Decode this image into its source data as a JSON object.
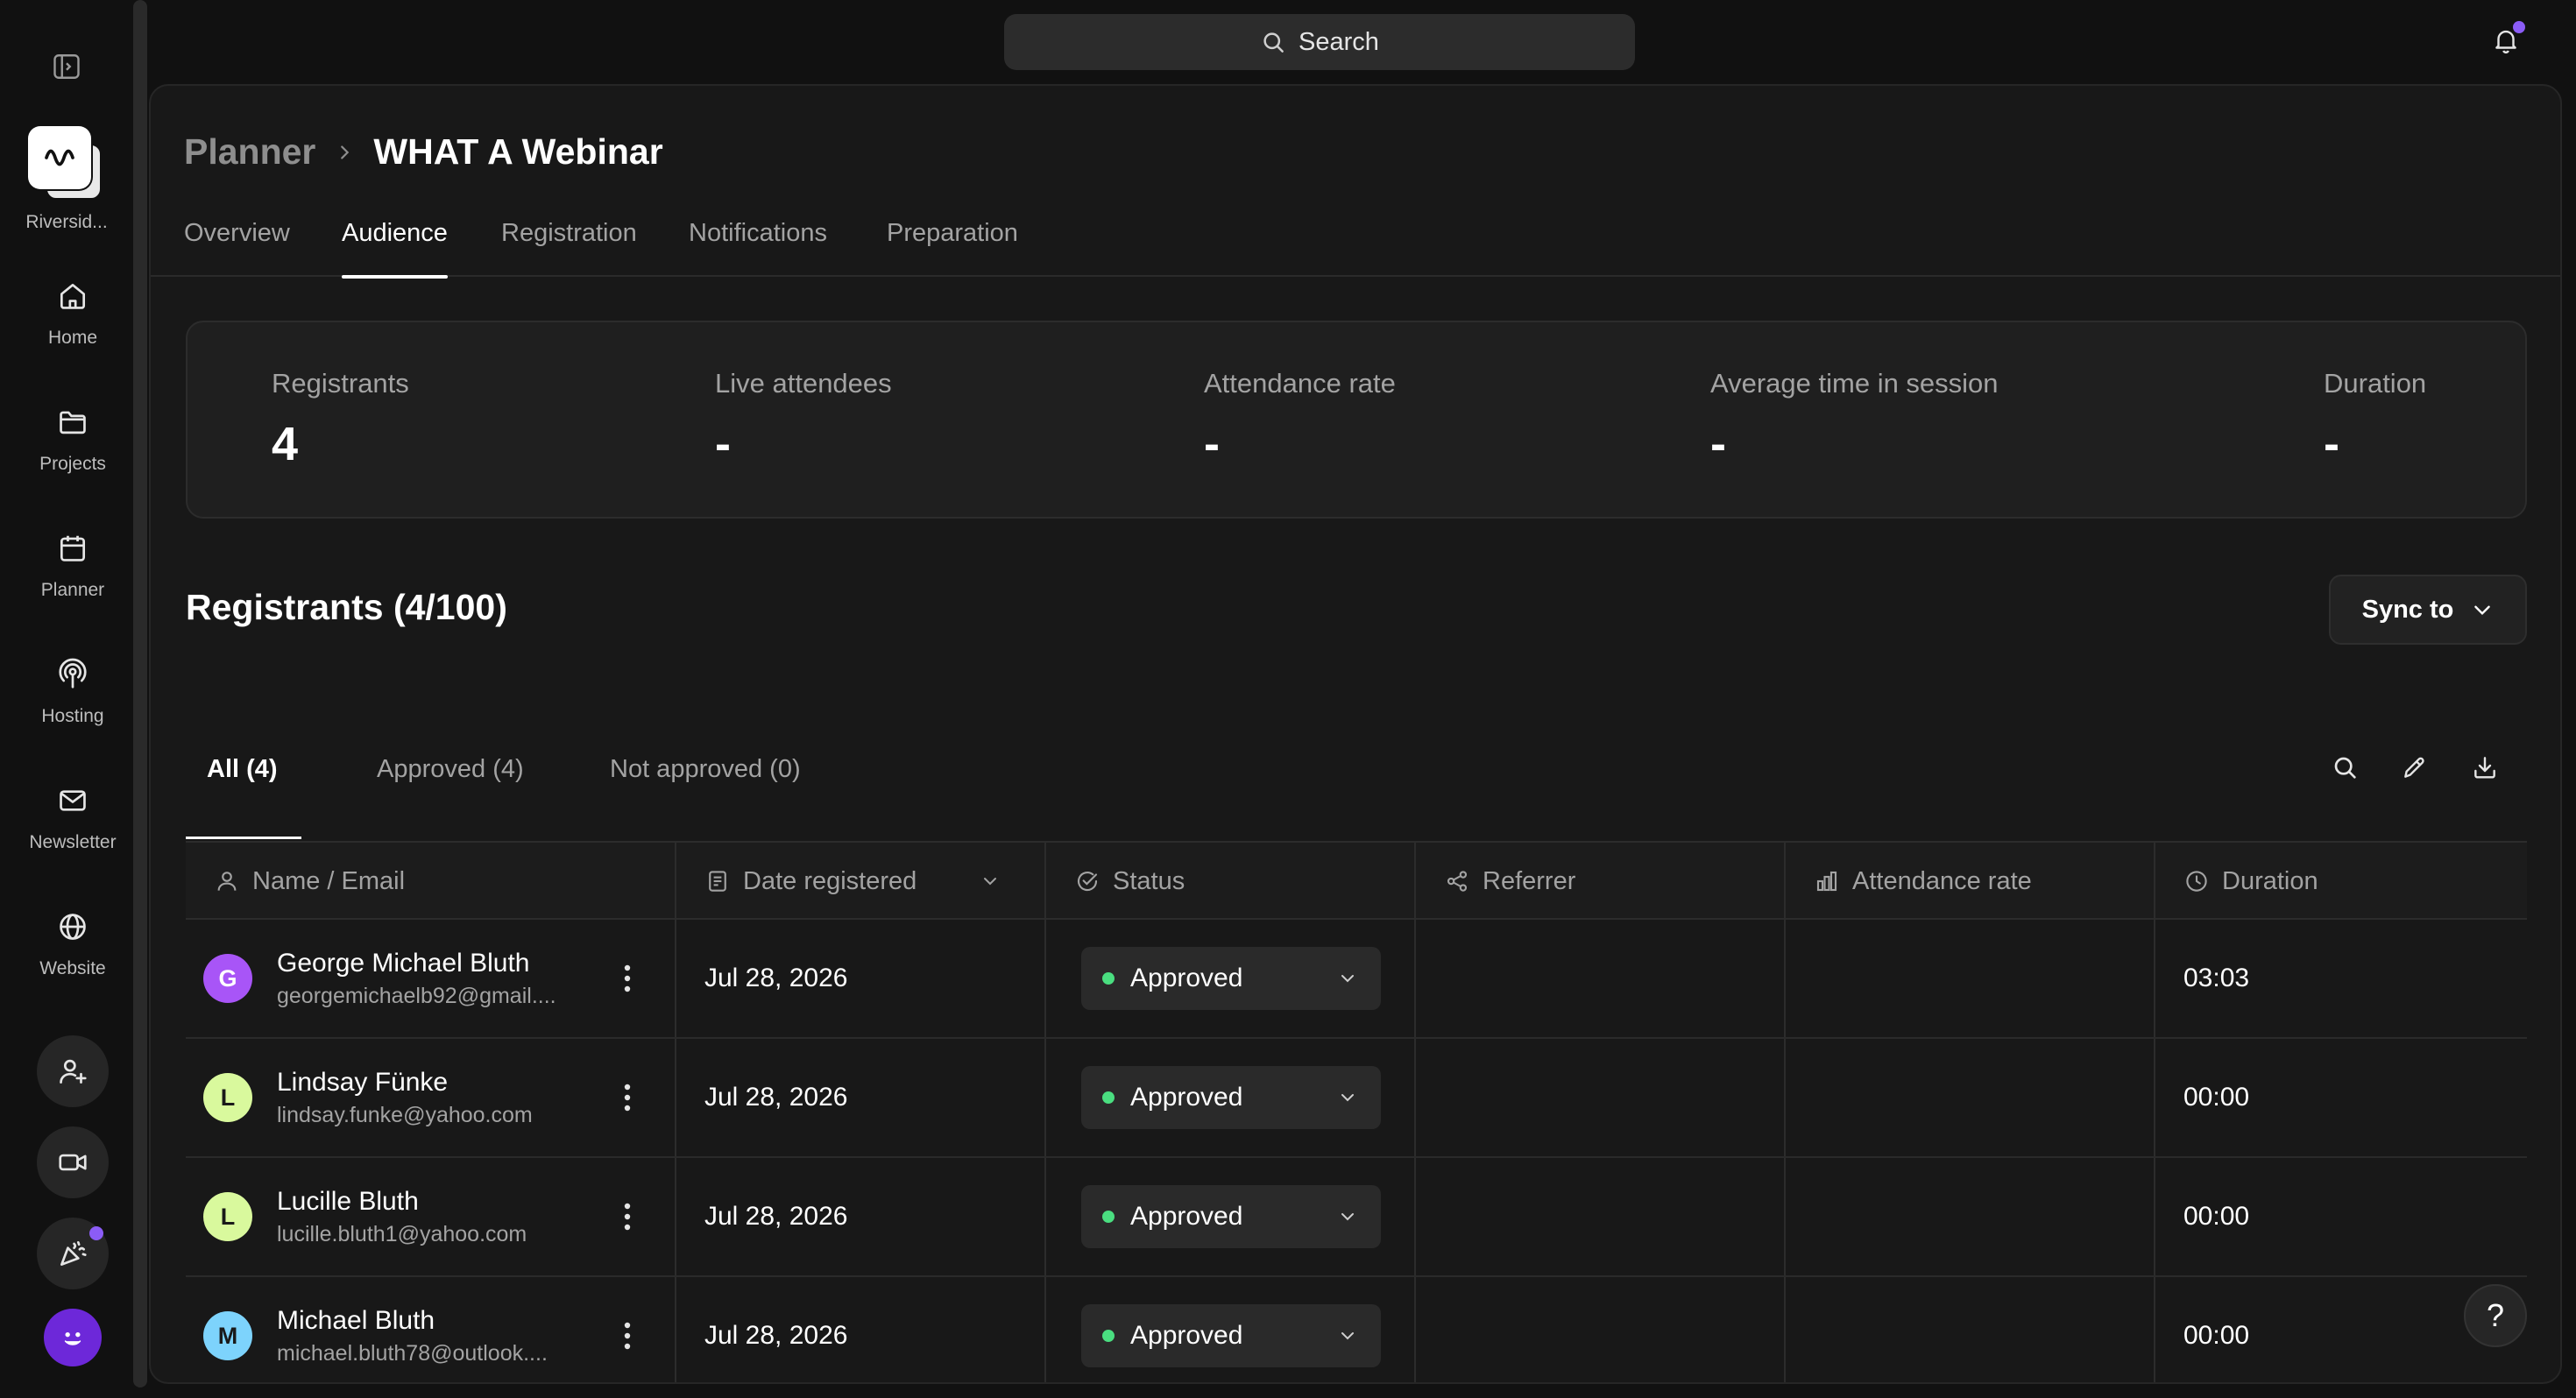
{
  "sidebar": {
    "workspace_label": "Riversid...",
    "items": [
      {
        "label": "Home",
        "icon": "home-icon"
      },
      {
        "label": "Projects",
        "icon": "folder-icon"
      },
      {
        "label": "Planner",
        "icon": "calendar-icon"
      },
      {
        "label": "Hosting",
        "icon": "podcast-icon"
      },
      {
        "label": "Newsletter",
        "icon": "mail-icon"
      },
      {
        "label": "Website",
        "icon": "globe-icon"
      }
    ],
    "actions": [
      "add-user-icon",
      "video-camera-icon",
      "party-popper-icon"
    ],
    "accent_color": "#8b5cf6"
  },
  "topbar": {
    "search_label": "Search"
  },
  "breadcrumb": {
    "parent": "Planner",
    "current": "WHAT A Webinar"
  },
  "tabs": [
    {
      "label": "Overview",
      "active": false
    },
    {
      "label": "Audience",
      "active": true
    },
    {
      "label": "Registration",
      "active": false
    },
    {
      "label": "Notifications",
      "active": false
    },
    {
      "label": "Preparation",
      "active": false
    }
  ],
  "stats": [
    {
      "label": "Registrants",
      "value": "4"
    },
    {
      "label": "Live attendees",
      "value": "-"
    },
    {
      "label": "Attendance rate",
      "value": "-"
    },
    {
      "label": "Average time in session",
      "value": "-"
    },
    {
      "label": "Duration",
      "value": "-"
    }
  ],
  "registrants": {
    "title": "Registrants (4/100)",
    "sync_label": "Sync to",
    "filters": [
      {
        "label": "All (4)",
        "active": true
      },
      {
        "label": "Approved (4)",
        "active": false
      },
      {
        "label": "Not approved (0)",
        "active": false
      }
    ],
    "columns": [
      "Name / Email",
      "Date registered",
      "Status",
      "Referrer",
      "Attendance rate",
      "Duration"
    ],
    "rows": [
      {
        "initial": "G",
        "avatar_color": "#a855f7",
        "name": "George Michael Bluth",
        "email": "georgemichaelb92@gmail....",
        "date": "Jul 28, 2026",
        "status": "Approved",
        "referrer": "",
        "attendance": "",
        "duration": "03:03"
      },
      {
        "initial": "L",
        "avatar_color": "#d9f99d",
        "name": "Lindsay Fünke",
        "email": "lindsay.funke@yahoo.com",
        "date": "Jul 28, 2026",
        "status": "Approved",
        "referrer": "",
        "attendance": "",
        "duration": "00:00"
      },
      {
        "initial": "L",
        "avatar_color": "#d9f99d",
        "name": "Lucille Bluth",
        "email": "lucille.bluth1@yahoo.com",
        "date": "Jul 28, 2026",
        "status": "Approved",
        "referrer": "",
        "attendance": "",
        "duration": "00:00"
      },
      {
        "initial": "M",
        "avatar_color": "#7dd3fc",
        "name": "Michael Bluth",
        "email": "michael.bluth78@outlook....",
        "date": "Jul 28, 2026",
        "status": "Approved",
        "referrer": "",
        "attendance": "",
        "duration": "00:00"
      }
    ],
    "status_color": "#4ade80"
  },
  "help_label": "?"
}
